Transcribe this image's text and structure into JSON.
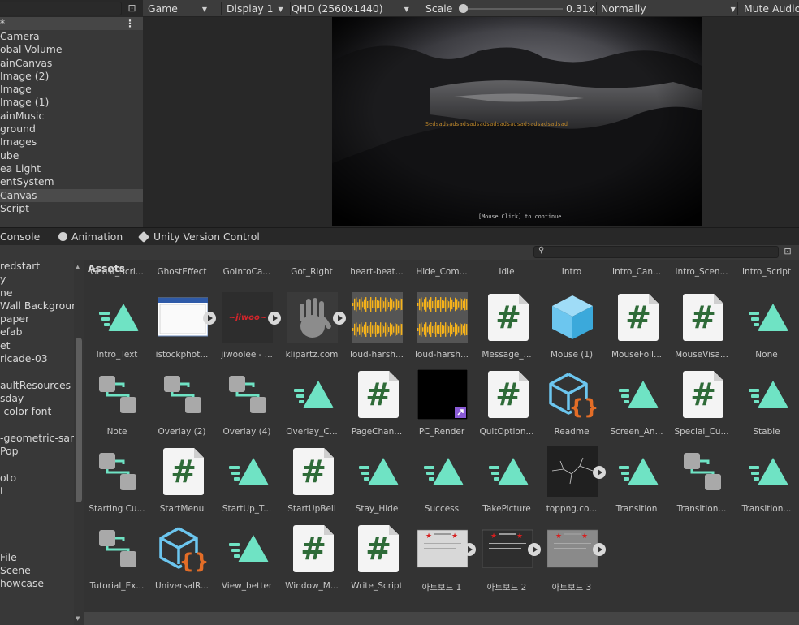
{
  "hierarchy": {
    "scene_name": "*",
    "items": [
      "Camera",
      "obal Volume",
      "ainCanvas",
      "Image (2)",
      "Image",
      "Image (1)",
      "ainMusic",
      "ground",
      " Images",
      "ube",
      "ea Light",
      "entSystem",
      "Canvas",
      "Script"
    ],
    "selected_index": 12
  },
  "game_toolbar": {
    "view": "Game",
    "display": "Display 1",
    "resolution": "QHD (2560x1440)",
    "scale_label": "Scale",
    "scale_value": "0.31x",
    "play_mode": "Normally",
    "mute": "Mute Audio"
  },
  "game_view": {
    "glyph_text": "Sedsadsadsadsadsadsadsadsadsadsadsadsadsad",
    "continue_text": "[Mouse Click] to continue"
  },
  "bottom_tabs": [
    "Console",
    "Animation",
    "Unity Version Control"
  ],
  "project": {
    "breadcrumb": "Assets",
    "tree": [
      "redstart",
      "y",
      "ne",
      " Wall Backgroun",
      "paper",
      "efab",
      "et",
      "ricade-03",
      "",
      "aultResources",
      "sday",
      "-color-font",
      "",
      "-geometric-sar",
      "Pop",
      "",
      "oto",
      "t",
      "",
      "",
      "",
      "",
      "File",
      "Scene",
      "howcase"
    ],
    "top_row_labels": [
      "Ghost_Scri...",
      "GhostEffect",
      "GoIntoCa...",
      "Got_Right",
      "heart-beat...",
      "Hide_Com...",
      "Idle",
      "Intro",
      "Intro_Can...",
      "Intro_Scen...",
      "Intro_Script"
    ],
    "rows": [
      [
        {
          "label": "Intro_Text",
          "icon": "animator-icon"
        },
        {
          "label": "istockphot...",
          "icon": "window-image-icon",
          "play": true
        },
        {
          "label": "jiwoolee - ...",
          "icon": "red-text-image-icon",
          "play": true
        },
        {
          "label": "klipartz.com",
          "icon": "hand-print-icon",
          "play": true
        },
        {
          "label": "loud-harsh...",
          "icon": "audio-waveform-icon"
        },
        {
          "label": "loud-harsh...",
          "icon": "audio-waveform-icon"
        },
        {
          "label": "Message_...",
          "icon": "csharp-script-icon"
        },
        {
          "label": "Mouse (1)",
          "icon": "prefab-cube-icon"
        },
        {
          "label": "MouseFoll...",
          "icon": "csharp-script-icon"
        },
        {
          "label": "MouseVisa...",
          "icon": "csharp-script-icon"
        },
        {
          "label": "None",
          "icon": "animator-icon"
        }
      ],
      [
        {
          "label": "Note",
          "icon": "animator-controller-icon"
        },
        {
          "label": "Overlay (2)",
          "icon": "animator-controller-icon"
        },
        {
          "label": "Overlay (4)",
          "icon": "animator-controller-icon"
        },
        {
          "label": "Overlay_C...",
          "icon": "animator-icon"
        },
        {
          "label": "PageChan...",
          "icon": "csharp-script-icon"
        },
        {
          "label": "PC_Render",
          "icon": "render-texture-icon"
        },
        {
          "label": "QuitOption...",
          "icon": "csharp-script-icon"
        },
        {
          "label": "Readme",
          "icon": "package-script-icon"
        },
        {
          "label": "Screen_An...",
          "icon": "animator-icon"
        },
        {
          "label": "Special_Cu...",
          "icon": "csharp-script-icon"
        },
        {
          "label": "Stable",
          "icon": "animator-icon"
        }
      ],
      [
        {
          "label": "Starting Cu...",
          "icon": "animator-controller-icon"
        },
        {
          "label": "StartMenu",
          "icon": "csharp-script-icon"
        },
        {
          "label": "StartUp_T...",
          "icon": "animator-icon"
        },
        {
          "label": "StartUpBell",
          "icon": "csharp-script-icon"
        },
        {
          "label": "Stay_Hide",
          "icon": "animator-icon"
        },
        {
          "label": "Success",
          "icon": "animator-icon"
        },
        {
          "label": "TakePicture",
          "icon": "animator-icon"
        },
        {
          "label": "toppng.co...",
          "icon": "crack-image-icon",
          "play": true
        },
        {
          "label": "Transition",
          "icon": "animator-icon"
        },
        {
          "label": "Transition...",
          "icon": "animator-controller-icon"
        },
        {
          "label": "Transition...",
          "icon": "animator-icon"
        }
      ],
      [
        {
          "label": "Tutorial_Ex...",
          "icon": "animator-controller-icon"
        },
        {
          "label": "UniversalR...",
          "icon": "package-script-icon"
        },
        {
          "label": "View_better",
          "icon": "animator-icon"
        },
        {
          "label": "Window_M...",
          "icon": "csharp-script-icon"
        },
        {
          "label": "Write_Script",
          "icon": "csharp-script-icon"
        },
        {
          "label": "아트보드 1",
          "icon": "artboard-light-icon",
          "play": true
        },
        {
          "label": "아트보드 2",
          "icon": "artboard-dark-icon",
          "play": true
        },
        {
          "label": "아트보드 3",
          "icon": "artboard-gray-icon",
          "play": true
        }
      ]
    ]
  },
  "colors": {
    "animator_teal": "#6fe3c4",
    "script_green": "#2e6b38",
    "prefab_blue": "#6cc6ef",
    "audio_yellow": "#f5b21b",
    "selection": "#4b4b4b"
  }
}
